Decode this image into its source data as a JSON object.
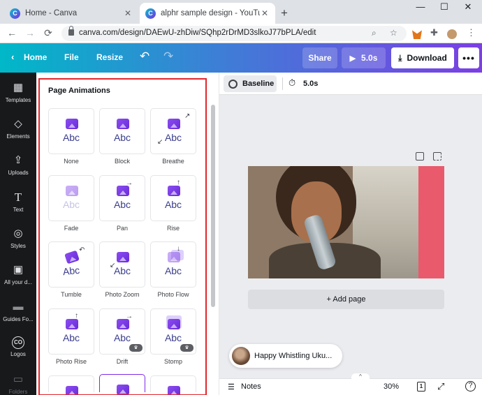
{
  "browser": {
    "tabs": [
      {
        "title": "Home - Canva",
        "active": false
      },
      {
        "title": "alphr sample design - YouTube T",
        "active": true
      }
    ],
    "favicon_letter": "C",
    "new_tab": "+",
    "window_controls": {
      "minimize": "—",
      "maximize": "☐",
      "close": "✕"
    },
    "nav": {
      "back": "←",
      "forward": "→",
      "reload": "⟳"
    },
    "url": "canva.com/design/DAEwU-zhDiw/SQhp2rDrMD3slkoJ77bPLA/edit",
    "icons": [
      "search-icon",
      "star-icon",
      "metamask-icon",
      "puzzle-icon",
      "profile-icon",
      "menu-icon"
    ]
  },
  "canva_header": {
    "home": "Home",
    "file": "File",
    "resize": "Resize",
    "undo_icon": "↶",
    "redo_icon": "↷",
    "share": "Share",
    "play_duration": "5.0s",
    "download": "Download",
    "more": "•••"
  },
  "rail": {
    "items": [
      {
        "label": "Templates",
        "icon": "▦"
      },
      {
        "label": "Elements",
        "icon": "◇"
      },
      {
        "label": "Uploads",
        "icon": "⇪"
      },
      {
        "label": "Text",
        "icon": "T"
      },
      {
        "label": "Styles",
        "icon": "◎"
      },
      {
        "label": "All your d...",
        "icon": "▣"
      },
      {
        "label": "Guides Fo...",
        "icon": "▬"
      },
      {
        "label": "Logos",
        "icon": "CO"
      },
      {
        "label": "Folders",
        "icon": "▭"
      }
    ]
  },
  "panel": {
    "title": "Page Animations",
    "animations": [
      {
        "label": "None",
        "text": "Abc",
        "premium": false
      },
      {
        "label": "Block",
        "text": "Abc",
        "premium": false
      },
      {
        "label": "Breathe",
        "text": "Abc",
        "premium": false
      },
      {
        "label": "Fade",
        "text": "Abc",
        "premium": false
      },
      {
        "label": "Pan",
        "text": "Abc",
        "premium": false
      },
      {
        "label": "Rise",
        "text": "Abc",
        "premium": false
      },
      {
        "label": "Tumble",
        "text": "Abc",
        "premium": false
      },
      {
        "label": "Photo Zoom",
        "text": "Abc",
        "premium": false
      },
      {
        "label": "Photo Flow",
        "text": "Abc",
        "premium": false
      },
      {
        "label": "Photo Rise",
        "text": "Abc",
        "premium": false
      },
      {
        "label": "Drift",
        "text": "Abc",
        "premium": true
      },
      {
        "label": "Stomp",
        "text": "Abc",
        "premium": true
      }
    ],
    "crown_icon": "♛"
  },
  "editor": {
    "baseline": "Baseline",
    "timer_icon": "⏱",
    "duration": "5.0s",
    "add_page": "+ Add page",
    "music_title": "Happy Whistling Uku...",
    "notes_icon": "☰",
    "notes": "Notes",
    "zoom": "30%",
    "page_count": "1",
    "fullscreen_icon": "⤢",
    "help_icon": "?",
    "chevron_up": "^",
    "colors": {
      "accent": "#7d2ae8",
      "highlight_frame": "#e0262b",
      "rail_bg": "#18191b"
    }
  }
}
